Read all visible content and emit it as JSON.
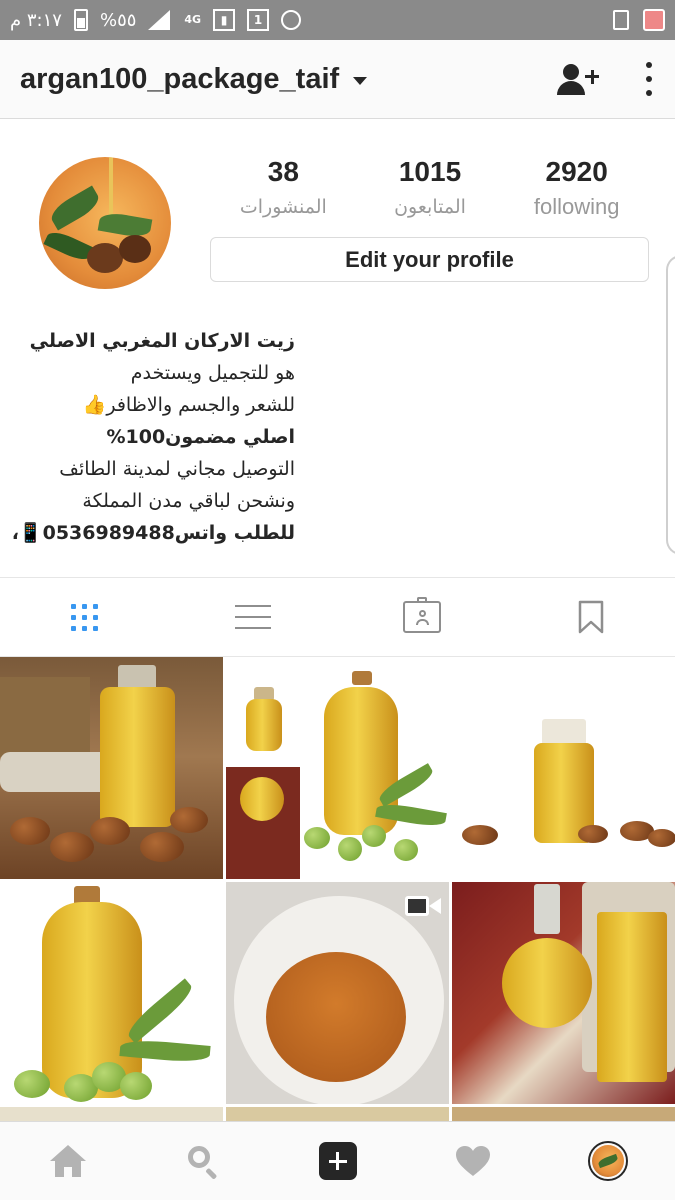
{
  "status_bar": {
    "time": "٣:١٧ م",
    "battery": "%٥٥",
    "network": "4G",
    "sim_slot": "1"
  },
  "header": {
    "username": "argan100_package_taif",
    "icons": [
      "chevron-down-icon",
      "add-user-icon",
      "more-vertical-icon"
    ]
  },
  "profile": {
    "stats": [
      {
        "value": "38",
        "label": "المنشورات"
      },
      {
        "value": "1015",
        "label": "المتابعون"
      },
      {
        "value": "2920",
        "label": "following"
      }
    ],
    "edit_button_label": "Edit your profile",
    "bio": {
      "name": "زيت الاركان المغربي الاصلي",
      "lines": [
        "هو للتجميل ويستخدم",
        "للشعر والجسم والاظافر👍",
        "اصلي مضمون100%",
        "التوصيل مجاني لمدينة الطائف",
        "ونشحن لباقي مدن المملكة",
        "للطلب واتس0536989488📱،"
      ]
    }
  },
  "tabs": {
    "icons": [
      "grid-view-icon",
      "list-view-icon",
      "tagged-photos-icon",
      "saved-bookmark-icon"
    ],
    "active_index": 0,
    "active_color": "#3897f0"
  },
  "grid_posts": {
    "count_visible": 6,
    "items": [
      "argan-oil-bottle",
      "oil-jugs-collage",
      "glass-bottle-argan-nuts",
      "olive-oil-jug",
      "oil-bowl-video",
      "perfume-oil-bottle"
    ]
  },
  "bottom_nav": {
    "icons": [
      "home-icon",
      "search-icon",
      "add-post-icon",
      "activity-heart-icon",
      "profile-avatar-icon"
    ]
  },
  "colors": {
    "text": "#262626",
    "muted": "#999999",
    "border": "#dbdbdb",
    "accent": "#3897f0",
    "status_bar": "#8a8a8a"
  }
}
